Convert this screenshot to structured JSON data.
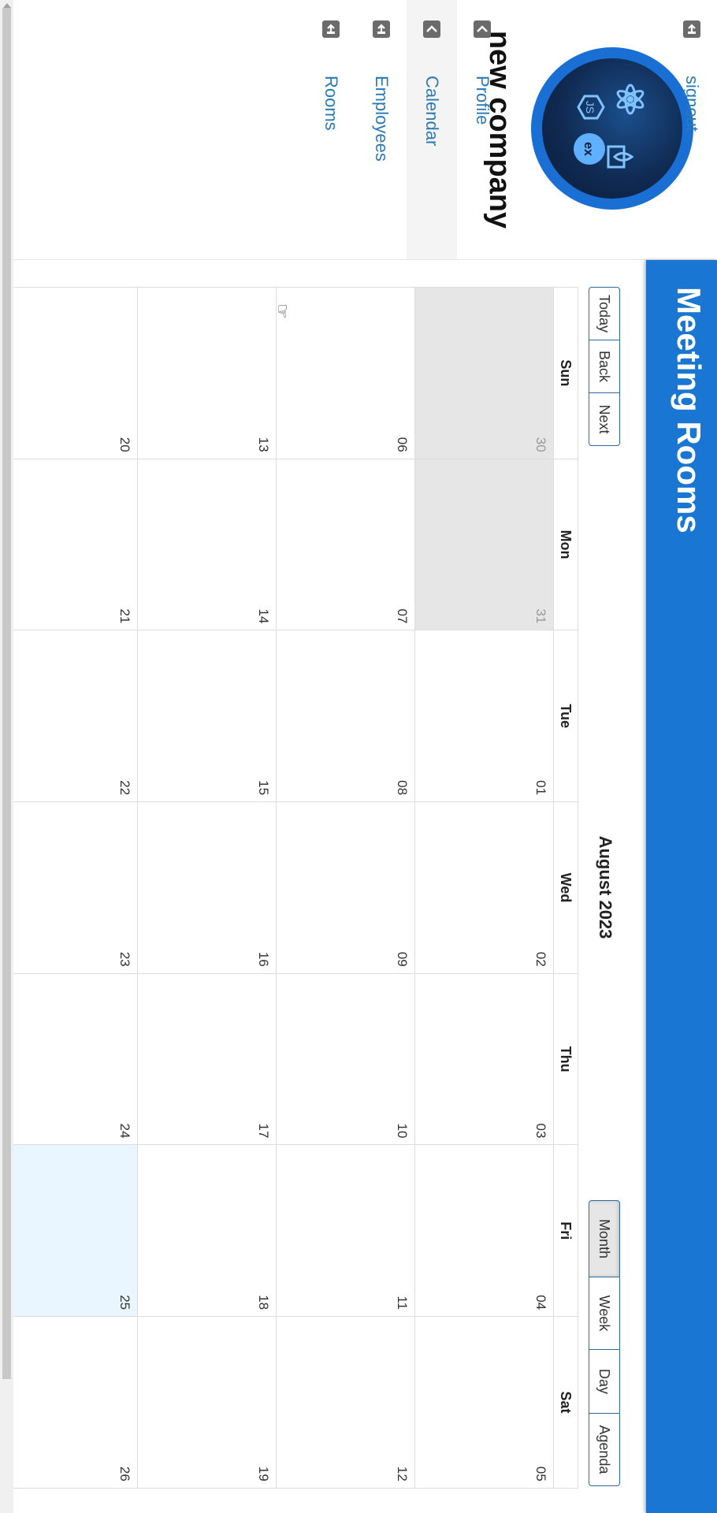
{
  "app": {
    "title": "Meeting Rooms"
  },
  "sidebar": {
    "company_name": "new company",
    "items": [
      {
        "label": "Rooms",
        "icon": "sign-out-icon"
      },
      {
        "label": "Employees",
        "icon": "sign-out-icon"
      },
      {
        "label": "Calendar",
        "icon": "chevron-left-icon",
        "active": true
      },
      {
        "label": "Profile",
        "icon": "chevron-left-icon"
      },
      {
        "label": "signout",
        "icon": "sign-out-icon"
      }
    ]
  },
  "toolbar": {
    "today_label": "Today",
    "back_label": "Back",
    "next_label": "Next",
    "month_title": "August 2023",
    "views": [
      "Month",
      "Week",
      "Day",
      "Agenda"
    ],
    "active_view": "Month"
  },
  "calendar": {
    "weekdays": [
      "Sun",
      "Mon",
      "Tue",
      "Wed",
      "Thu",
      "Fri",
      "Sat"
    ],
    "weeks": [
      [
        "30",
        "31",
        "01",
        "02",
        "03",
        "04",
        "05"
      ],
      [
        "06",
        "07",
        "08",
        "09",
        "10",
        "11",
        "12"
      ],
      [
        "13",
        "14",
        "15",
        "16",
        "17",
        "18",
        "19"
      ],
      [
        "20",
        "21",
        "22",
        "23",
        "24",
        "25",
        "26"
      ]
    ],
    "highlighted_day": "25"
  },
  "colors": {
    "header": "#1976d2",
    "link": "#2a7ab8",
    "today_bg": "#eaf6ff",
    "off_range_bg": "#e6e6e6"
  }
}
